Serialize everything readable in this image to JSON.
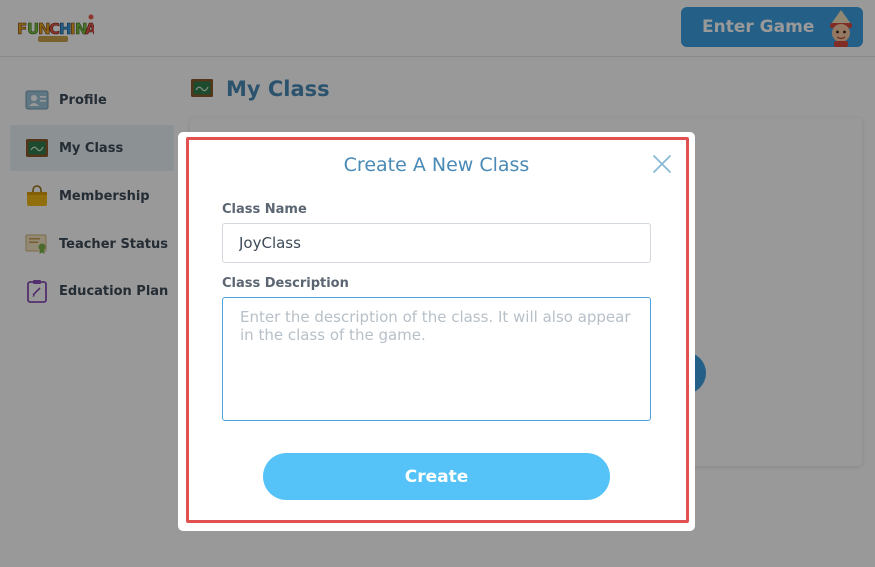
{
  "app": {
    "logo_text": "FunChina",
    "brand_colors": {
      "accent": "#3b9fe2",
      "title": "#4a8ab6",
      "create_button": "#55c3f7",
      "highlight": "#e0514f"
    }
  },
  "header": {
    "enter_game_label": "Enter Game"
  },
  "sidebar": {
    "items": [
      {
        "label": "Profile",
        "icon": "profile-card-icon",
        "active": false
      },
      {
        "label": "My Class",
        "icon": "chalkboard-icon",
        "active": true
      },
      {
        "label": "Membership",
        "icon": "shopping-bag-icon",
        "active": false
      },
      {
        "label": "Teacher Status",
        "icon": "certificate-icon",
        "active": false
      },
      {
        "label": "Education Plan",
        "icon": "clipboard-icon",
        "active": false
      }
    ]
  },
  "main": {
    "title": "My Class",
    "title_icon": "chalkboard-icon"
  },
  "modal": {
    "title": "Create A New Class",
    "close_icon": "close-icon",
    "class_name_label": "Class Name",
    "class_name_value": "JoyClass",
    "class_description_label": "Class Description",
    "class_description_value": "",
    "class_description_placeholder": "Enter the description of the class. It will also appear in the class of the game.",
    "create_label": "Create"
  }
}
